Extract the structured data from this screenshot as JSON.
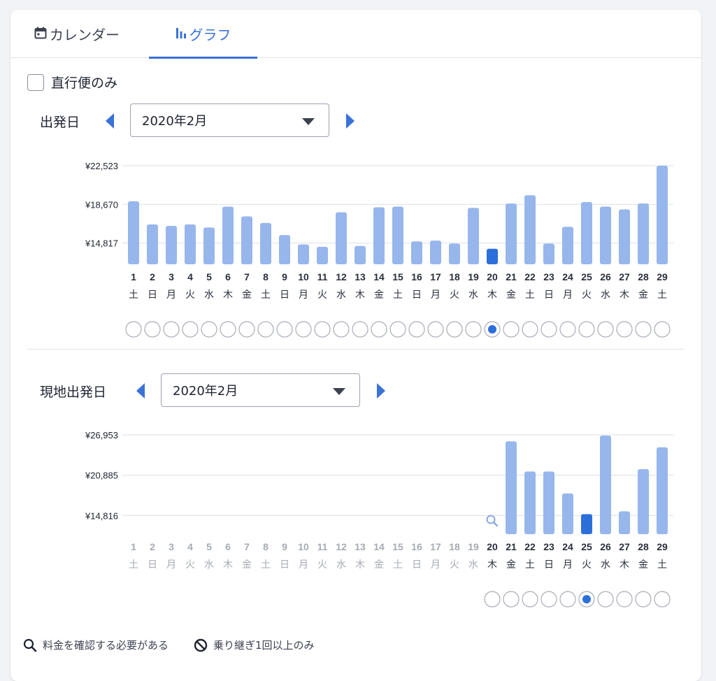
{
  "tabs": [
    {
      "label": "カレンダー",
      "icon": "calendar-icon",
      "active": false
    },
    {
      "label": "グラフ",
      "icon": "bar-chart-icon",
      "active": true
    }
  ],
  "filter": {
    "direct_only_label": "直行便のみ",
    "checked": false
  },
  "colors": {
    "accent": "#3a72d6",
    "bar": "#97b6ec",
    "bar_selected": "#2c6fdb",
    "disabled_text": "#a6aab3"
  },
  "departure": {
    "label": "出発日",
    "month": "2020年2月"
  },
  "return": {
    "label": "現地出発日",
    "month": "2020年2月"
  },
  "chart_data": [
    {
      "type": "bar",
      "categories": [
        "1",
        "2",
        "3",
        "4",
        "5",
        "6",
        "7",
        "8",
        "9",
        "10",
        "11",
        "12",
        "13",
        "14",
        "15",
        "16",
        "17",
        "18",
        "19",
        "20",
        "21",
        "22",
        "23",
        "24",
        "25",
        "26",
        "27",
        "28",
        "29"
      ],
      "weekdays": [
        "土",
        "日",
        "月",
        "火",
        "水",
        "木",
        "金",
        "土",
        "日",
        "月",
        "火",
        "水",
        "木",
        "金",
        "土",
        "日",
        "月",
        "火",
        "水",
        "木",
        "金",
        "土",
        "日",
        "月",
        "火",
        "水",
        "木",
        "金",
        "土"
      ],
      "values": [
        18980,
        16670,
        16520,
        16670,
        16370,
        18450,
        17470,
        16820,
        15620,
        14680,
        14440,
        17880,
        14530,
        18380,
        18450,
        14980,
        15060,
        14760,
        18320,
        14250,
        18750,
        19580,
        14760,
        16440,
        18900,
        18450,
        18170,
        18760,
        22523
      ],
      "ylim": [
        12700,
        22523
      ],
      "yticks": [
        "¥22,523",
        "¥18,670",
        "¥14,817"
      ],
      "ytick_values": [
        22523,
        18670,
        14817
      ],
      "selected_index": 19,
      "disabled_count": 0
    },
    {
      "type": "bar",
      "categories": [
        "1",
        "2",
        "3",
        "4",
        "5",
        "6",
        "7",
        "8",
        "9",
        "10",
        "11",
        "12",
        "13",
        "14",
        "15",
        "16",
        "17",
        "18",
        "19",
        "20",
        "21",
        "22",
        "23",
        "24",
        "25",
        "26",
        "27",
        "28",
        "29"
      ],
      "weekdays": [
        "土",
        "日",
        "月",
        "火",
        "水",
        "木",
        "金",
        "土",
        "日",
        "月",
        "火",
        "水",
        "木",
        "金",
        "土",
        "日",
        "月",
        "火",
        "水",
        "木",
        "金",
        "土",
        "日",
        "月",
        "火",
        "水",
        "木",
        "金",
        "土"
      ],
      "values": [
        null,
        null,
        null,
        null,
        null,
        null,
        null,
        null,
        null,
        null,
        null,
        null,
        null,
        null,
        null,
        null,
        null,
        null,
        null,
        null,
        25980,
        21440,
        21440,
        18130,
        15020,
        26850,
        15440,
        21790,
        25090
      ],
      "ylim": [
        12000,
        26953
      ],
      "yticks": [
        "¥26,953",
        "¥20,885",
        "¥14,816"
      ],
      "ytick_values": [
        26953,
        20885,
        14816
      ],
      "selected_index": 24,
      "search_marker_index": 19,
      "disabled_count": 19
    }
  ],
  "legend": [
    {
      "icon": "search-icon",
      "label": "料金を確認する必要がある"
    },
    {
      "icon": "prohibited-icon",
      "label": "乗り継ぎ1回以上のみ"
    }
  ]
}
